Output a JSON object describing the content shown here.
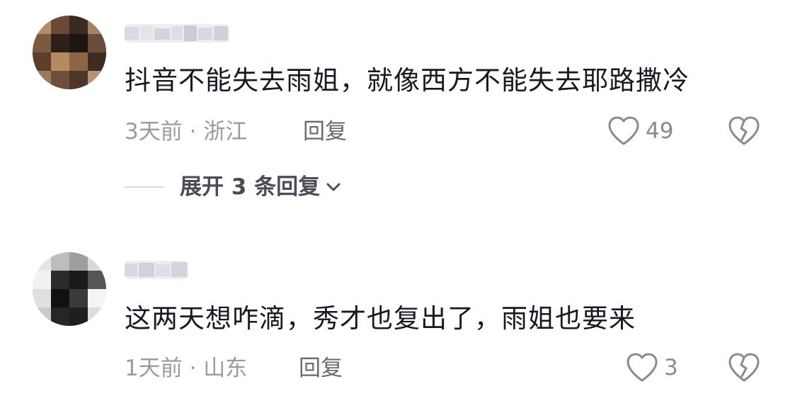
{
  "comments": [
    {
      "avatar_icon": "pixelated-avatar",
      "username_icon": "pixelated-username",
      "text": "抖音不能失去雨姐，就像西方不能失去耶路撒冷",
      "meta": "3天前 · 浙江",
      "reply_label": "回复",
      "like_count": "49",
      "expand_label": "展开 3 条回复"
    },
    {
      "avatar_icon": "pixelated-avatar",
      "username_icon": "pixelated-username",
      "text": "这两天想咋滴，秀才也复出了，雨姐也要来",
      "meta": "1天前 · 山东",
      "reply_label": "回复",
      "like_count": "3"
    }
  ],
  "colors": {
    "text_primary": "#161823",
    "text_secondary": "#9a9ba1",
    "reply": "#666a73",
    "icon_gray": "#8a8b91"
  },
  "icons": {
    "like": "heart-outline-icon",
    "dislike": "broken-heart-icon",
    "expand": "chevron-down-icon"
  }
}
